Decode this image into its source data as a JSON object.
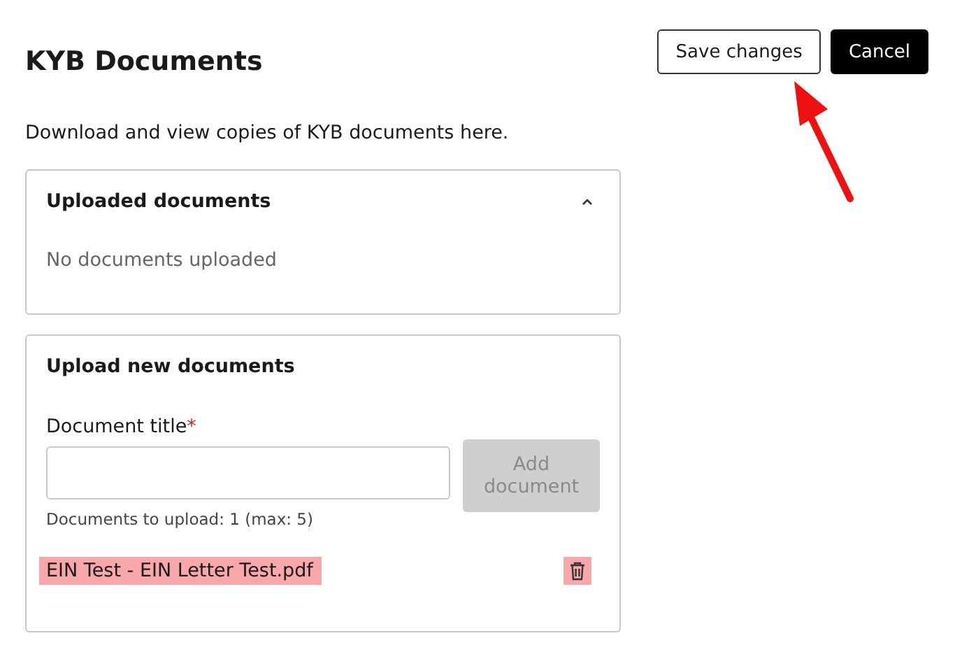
{
  "title": "KYB Documents",
  "buttons": [
    {
      "label": "Save changes",
      "kind": "secondary"
    },
    {
      "label": "Cancel",
      "kind": "primary"
    }
  ],
  "description": "Download and view copies of KYB documents here.",
  "uploaded": {
    "title": "Uploaded documents",
    "expanded": true,
    "empty_text": "No documents uploaded"
  },
  "upload": {
    "title": "Upload new documents",
    "field": {
      "label": "Document title",
      "required_mark": "*"
    },
    "add_button": {
      "label": "Add document",
      "disabled": true
    },
    "hint": "Documents to upload: 1 (max: 5)",
    "files": [
      {
        "name": "EIN Test - EIN Letter Test.pdf",
        "highlighted": true
      }
    ]
  }
}
